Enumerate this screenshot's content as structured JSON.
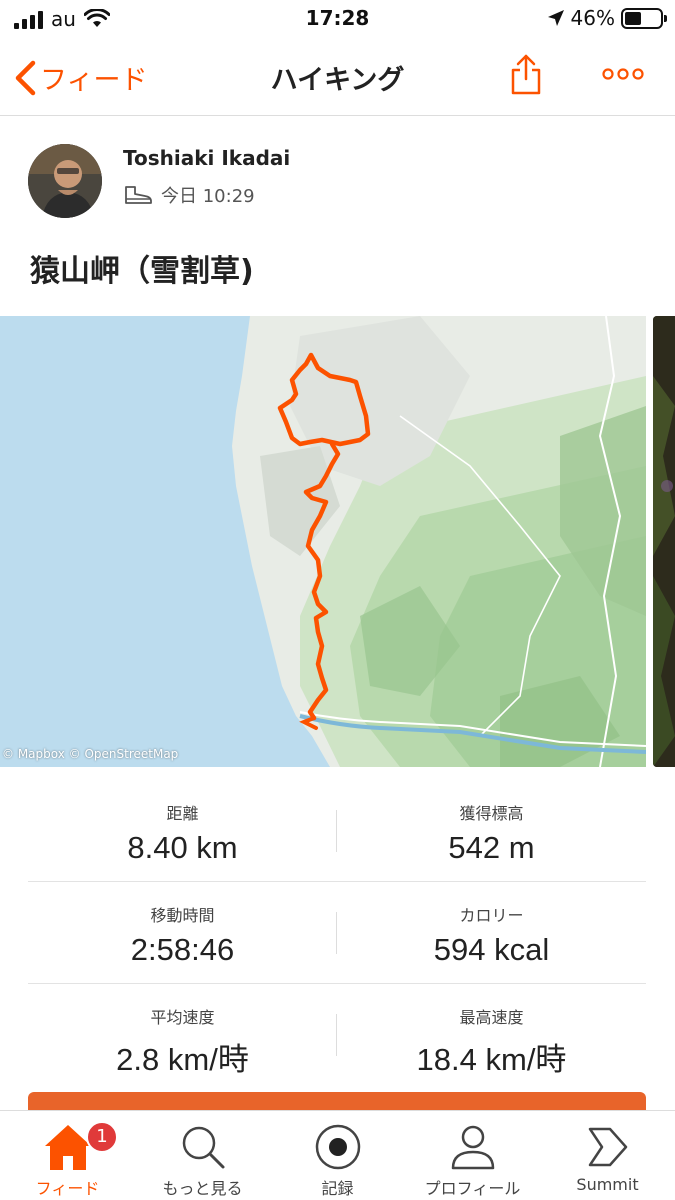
{
  "status_bar": {
    "carrier": "au",
    "time": "17:28",
    "battery": "46%",
    "battery_level": 0.46
  },
  "nav": {
    "back_label": "フィード",
    "title": "ハイキング"
  },
  "activity": {
    "athlete_name": "Toshiaki Ikadai",
    "activity_icon": "hiking-boot-icon",
    "datetime": "今日 10:29",
    "title": "猿山岬（雪割草)"
  },
  "map": {
    "attribution": "© Mapbox © OpenStreetMap",
    "route_color": "#fc5200"
  },
  "stats": [
    {
      "left": {
        "label": "距離",
        "value": "8.40 km"
      },
      "right": {
        "label": "獲得標高",
        "value": "542 m"
      }
    },
    {
      "left": {
        "label": "移動時間",
        "value": "2:58:46"
      },
      "right": {
        "label": "カロリー",
        "value": "594 kcal"
      }
    },
    {
      "left": {
        "label": "平均速度",
        "value": "2.8 km/時"
      },
      "right": {
        "label": "最高速度",
        "value": "18.4 km/時"
      }
    }
  ],
  "tab_bar": {
    "tabs": [
      {
        "label": "フィード",
        "icon": "home-icon",
        "active": true,
        "badge": "1"
      },
      {
        "label": "もっと見る",
        "icon": "search-icon"
      },
      {
        "label": "記録",
        "icon": "record-icon"
      },
      {
        "label": "プロフィール",
        "icon": "profile-icon"
      },
      {
        "label": "Summit",
        "icon": "summit-icon"
      }
    ]
  },
  "colors": {
    "accent": "#fc5200",
    "badge": "#e03a3a"
  }
}
